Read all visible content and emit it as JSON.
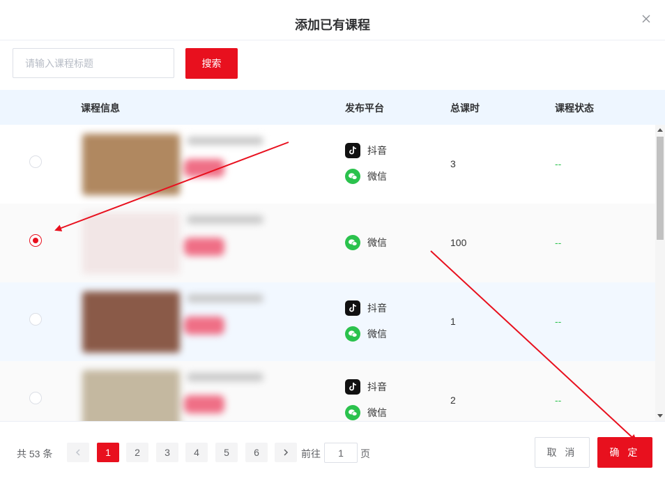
{
  "dialog": {
    "title": "添加已有课程"
  },
  "search": {
    "placeholder": "请输入课程标题",
    "button": "搜索"
  },
  "table": {
    "headers": {
      "info": "课程信息",
      "platform": "发布平台",
      "hours": "总课时",
      "status": "课程状态"
    },
    "rows": [
      {
        "selected": false,
        "platforms": [
          "抖音",
          "微信"
        ],
        "hours": "3",
        "status": "--",
        "thumb_color": "#b08860"
      },
      {
        "selected": true,
        "platforms": [
          "微信"
        ],
        "hours": "100",
        "status": "--",
        "thumb_color": "#f2e6e6"
      },
      {
        "selected": false,
        "platforms": [
          "抖音",
          "微信"
        ],
        "hours": "1",
        "status": "--",
        "thumb_color": "#8a5a48"
      },
      {
        "selected": false,
        "platforms": [
          "抖音",
          "微信"
        ],
        "hours": "2",
        "status": "--",
        "thumb_color": "#c4b8a0"
      }
    ]
  },
  "pagination": {
    "total": "共 53 条",
    "pages": [
      "1",
      "2",
      "3",
      "4",
      "5",
      "6"
    ],
    "current": "1",
    "goto_prefix": "前往",
    "goto_value": "1",
    "goto_suffix": "页"
  },
  "footer": {
    "cancel": "取 消",
    "confirm": "确 定"
  },
  "colors": {
    "accent": "#e8101e",
    "header_bg": "#eef6ff",
    "status": "#2bc24d"
  }
}
